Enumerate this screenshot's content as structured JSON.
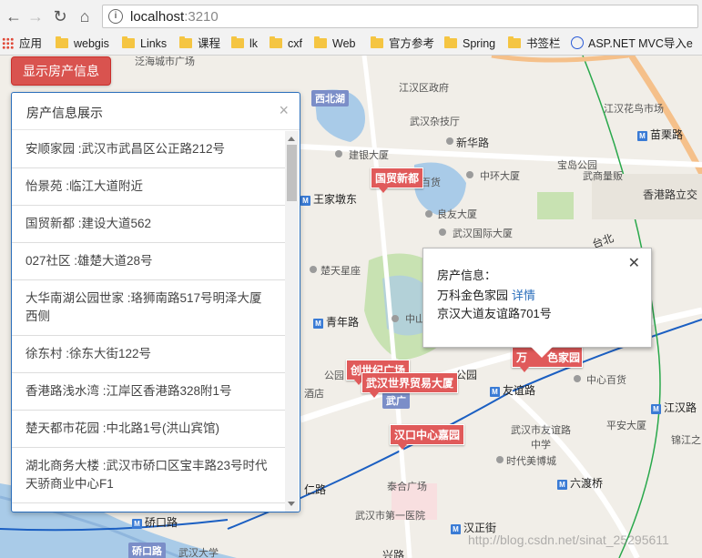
{
  "browser": {
    "url_host": "localhost",
    "url_port": ":3210",
    "bookmarks": [
      {
        "label": "应用",
        "icon": "apps-grid-icon"
      },
      {
        "label": "webgis",
        "icon": "folder-icon"
      },
      {
        "label": "Links",
        "icon": "folder-icon"
      },
      {
        "label": "课程",
        "icon": "folder-icon"
      },
      {
        "label": "lk",
        "icon": "folder-icon"
      },
      {
        "label": "cxf",
        "icon": "folder-icon"
      },
      {
        "label": "Web",
        "icon": "folder-icon"
      },
      {
        "label": "官方参考",
        "icon": "folder-icon"
      },
      {
        "label": "Spring",
        "icon": "folder-icon"
      },
      {
        "label": "书签栏",
        "icon": "folder-icon"
      },
      {
        "label": "ASP.NET MVC导入e",
        "icon": "aspnet-icon"
      }
    ]
  },
  "app": {
    "show_button": "显示房产信息",
    "panel_title": "房产信息展示",
    "houses": [
      "安顺家园 :武汉市武昌区公正路212号",
      "怡景苑 :临江大道附近",
      "国贸新都 :建设大道562",
      "027社区 :雄楚大道28号",
      "大华南湖公园世家 :珞狮南路517号明泽大厦西侧",
      "徐东村 :徐东大街122号",
      "香港路浅水湾 :江岸区香港路328附1号",
      "楚天都市花园 :中北路1号(洪山宾馆)",
      "湖北商务大楼 :武汉市硚口区宝丰路23号时代天骄商业中心F1"
    ]
  },
  "popup": {
    "title": "房产信息：",
    "name": "万科金色家园",
    "detail_link": "详情",
    "address": "京汉大道友谊路701号"
  },
  "map": {
    "labels": {
      "xibeihu": "西北湖",
      "jianghan_gov": "江汉区政府",
      "wuhan_zajitang": "武汉杂技厅",
      "xinhualu": "新华路",
      "jianyin": "建银大厦",
      "zhonghuan": "中环大厦",
      "baodian": "宝岛公园",
      "wangjiadun": "王家墩东",
      "guomao": "国贸新都",
      "wushang": "武商量贩",
      "xianggang": "香港路立交",
      "jianghanhua": "江汉花鸟市场",
      "miaoli": "苗栗路",
      "guomaobaihuo": "国贸百货",
      "liangyou": "良友大厦",
      "wuhanintl": "武汉国际大厦",
      "chutian": "楚天星座",
      "qingnian": "青年路",
      "zhongshan": "中山",
      "chuangshiji": "创世纪广场",
      "wuhanworld": "武汉世界贸易大厦",
      "jiangpark": "公园",
      "youyi": "友谊路",
      "jiudian": "酒店",
      "wuguang": "武广",
      "zhongxinbaihuo": "中心百货",
      "jiangdao": "江汉路",
      "pingan": "平安大厦",
      "jinjiang": "锦江之",
      "hankou": "汉口中心嘉园",
      "school": "武汉市友谊路中学",
      "shidai": "时代美博城",
      "liudu": "六渡桥",
      "taihe": "泰合广场",
      "diyi": "武汉市第一医院",
      "hanzheng": "汉正街",
      "jiaokou": "硚口路",
      "jiaokou2": "硚口路",
      "jiaokou3": "硚口路",
      "renlu": "仁路",
      "wuhandx": "武汉大学",
      "xingli": "兴路",
      "guanggu": "泛海城市广场",
      "wanke": "万",
      "jinse": "色家园",
      "taibei": "台北"
    },
    "watermark": "http://blog.csdn.net/sinat_25295611"
  }
}
